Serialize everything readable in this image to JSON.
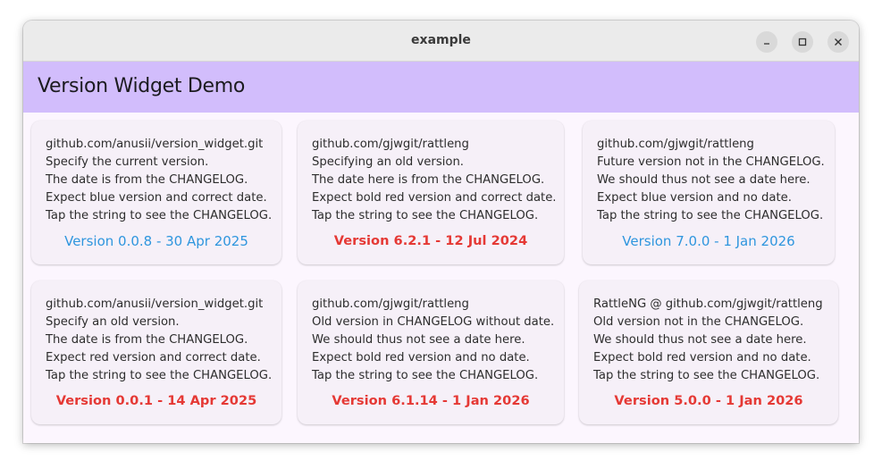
{
  "window": {
    "title": "example"
  },
  "appbar": {
    "title": "Version Widget Demo"
  },
  "colors": {
    "appbar_bg": "#d2bdfc",
    "blue_version": "#2f96de",
    "red_version": "#e53935"
  },
  "cards": [
    {
      "lines": [
        "github.com/anusii/version_widget.git",
        "Specify the current version.",
        "The date is from the CHANGELOG.",
        "Expect blue version and correct date.",
        "Tap the string to see the CHANGELOG."
      ],
      "version": "Version 0.0.8 - 30 Apr 2025",
      "style": "blue"
    },
    {
      "lines": [
        "github.com/gjwgit/rattleng",
        "Specifying an old version.",
        "The date here is from the CHANGELOG.",
        "Expect bold red version and correct date.",
        "Tap the string to see the CHANGELOG."
      ],
      "version": "Version 6.2.1 - 12 Jul 2024",
      "style": "red"
    },
    {
      "lines": [
        "github.com/gjwgit/rattleng",
        "Future version not in the CHANGELOG.",
        "We should thus not see a date here.",
        "Expect blue version and no date.",
        "Tap the string to see the CHANGELOG."
      ],
      "version": "Version 7.0.0 - 1 Jan 2026",
      "style": "blue"
    },
    {
      "lines": [
        "github.com/anusii/version_widget.git",
        "Specify an old version.",
        "The date is from the CHANGELOG.",
        "Expect red version and correct date.",
        "Tap the string to see the CHANGELOG."
      ],
      "version": "Version 0.0.1 - 14 Apr 2025",
      "style": "red"
    },
    {
      "lines": [
        "github.com/gjwgit/rattleng",
        "Old version in CHANGELOG without date.",
        "We should thus not see a date here.",
        "Expect bold red version and no date.",
        "Tap the string to see the CHANGELOG."
      ],
      "version": "Version 6.1.14 - 1 Jan 2026",
      "style": "red"
    },
    {
      "lines": [
        "RattleNG @ github.com/gjwgit/rattleng",
        "Old version not in the CHANGELOG.",
        "We should thus not see a date here.",
        "Expect bold red version and no date.",
        "Tap the string to see the CHANGELOG."
      ],
      "version": "Version 5.0.0 - 1 Jan 2026",
      "style": "red"
    }
  ]
}
